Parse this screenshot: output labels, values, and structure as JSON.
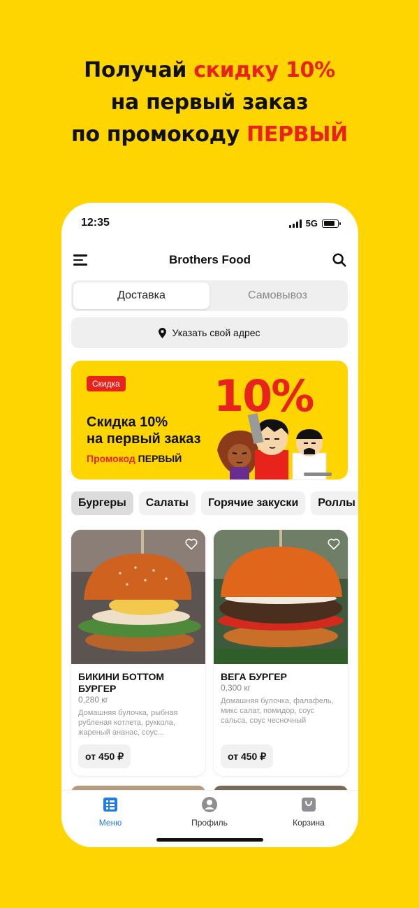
{
  "headline": {
    "line1_prefix": "Получай ",
    "line1_accent": "скидку 10%",
    "line2": "на первый заказ",
    "line3_prefix": "по промокоду ",
    "line3_accent": "ПЕРВЫЙ"
  },
  "status_bar": {
    "time": "12:35",
    "network": "5G",
    "battery_level": 0.8
  },
  "app_bar": {
    "title": "Brothers Food",
    "menu_icon": "hamburger-icon",
    "search_icon": "search-icon"
  },
  "delivery_mode": {
    "options": [
      "Доставка",
      "Самовывоз"
    ],
    "selected": "Доставка"
  },
  "address": {
    "label": "Указать свой адрес",
    "icon": "location-pin-icon"
  },
  "promo_banner": {
    "badge": "Скидка",
    "big_text": "10%",
    "title_line1": "Скидка 10%",
    "title_line2": "на первый заказ",
    "code_label": "Промокод",
    "code_value": "ПЕРВЫЙ"
  },
  "categories": {
    "items": [
      "Бургеры",
      "Салаты",
      "Горячие закуски",
      "Роллы"
    ],
    "selected": "Бургеры"
  },
  "products": [
    {
      "name": "БИКИНИ БОТТОМ БУРГЕР",
      "weight": "0,280 кг",
      "description": "Домашняя булочка, рыбная рубленая котлета, руккола, жареный ананас, соус...",
      "price": "от 450 ₽"
    },
    {
      "name": "ВЕГА БУРГЕР",
      "weight": "0,300 кг",
      "description": "Домашняя булочка, фалафель, микс салат, помидор, соус сальса, соус чесночный",
      "price": "от 450 ₽"
    }
  ],
  "tab_bar": {
    "items": [
      {
        "label": "Меню",
        "icon": "menu-list-icon"
      },
      {
        "label": "Профиль",
        "icon": "profile-icon"
      },
      {
        "label": "Корзина",
        "icon": "cart-bag-icon"
      }
    ],
    "selected": "Меню"
  },
  "colors": {
    "background": "#FFD500",
    "accent_red": "#E8231B",
    "active_tab_blue": "#1E7CE8"
  }
}
